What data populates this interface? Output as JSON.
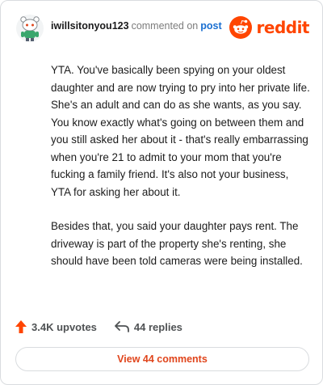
{
  "comment": {
    "username": "iwillsitonyou123",
    "verb": "commented on",
    "target": "post",
    "paragraphs": [
      "YTA. You've basically been spying on your oldest daughter and are now trying to pry into her private life. She's an adult and can do as she wants, as you say. You know exactly what's going on between them and you still asked her about it - that's really embarrassing when you're 21 to admit to your mom that you're fucking a family friend. It's also not your business, YTA for asking her about it.",
      "Besides that, you said your daughter pays rent. The driveway is part of the property she's renting, she should have been told cameras were being installed."
    ]
  },
  "brand": {
    "wordmark": "reddit",
    "icon": "reddit-snoo-icon",
    "color": "#ff4500"
  },
  "stats": {
    "upvotes": "3.4K upvotes",
    "upvote_icon": "upvote-arrow-icon",
    "upvote_color": "#ff4500",
    "replies": "44 replies",
    "reply_icon": "reply-arrow-icon"
  },
  "actions": {
    "view_comments": "View 44 comments",
    "accent": "#e0451c"
  }
}
